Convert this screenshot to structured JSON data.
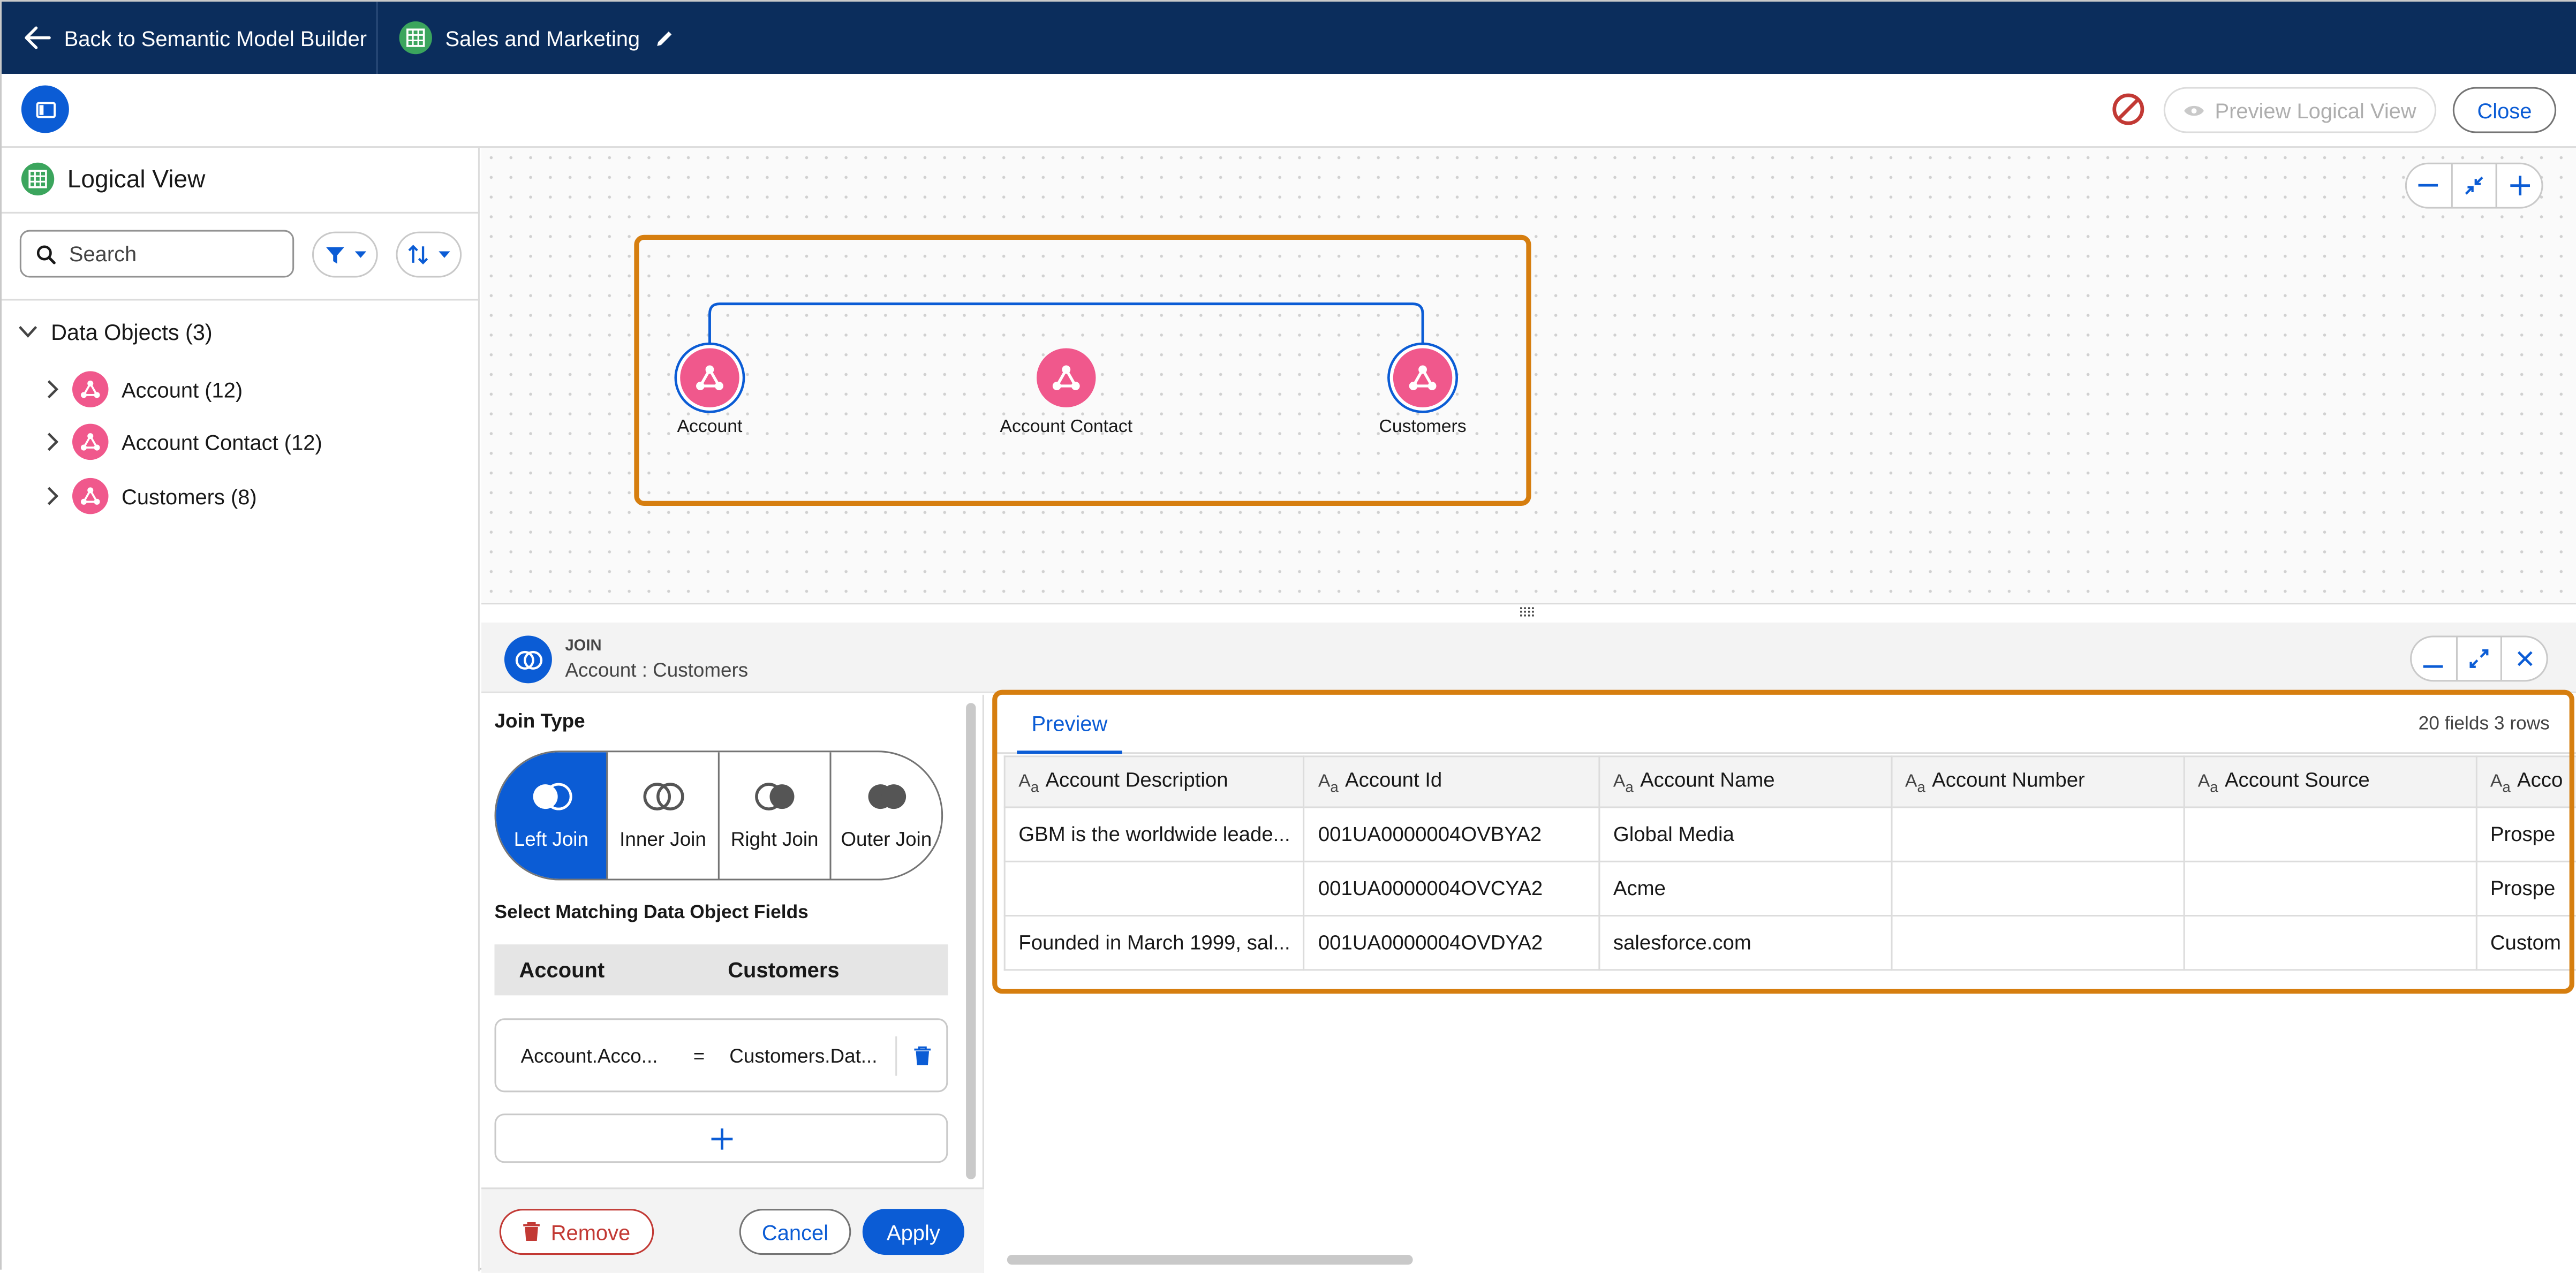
{
  "colors": {
    "nav_bg": "#0b2d5c",
    "brand_blue": "#0b5cd5",
    "object_pink": "#f0588c",
    "highlight_orange": "#d67e0f",
    "destructive": "#c23934"
  },
  "topnav": {
    "back_label": "Back to Semantic Model Builder",
    "model_name": "Sales and Marketing"
  },
  "toolbar": {
    "preview_label": "Preview Logical View",
    "close_label": "Close"
  },
  "sidebar": {
    "title": "Logical View",
    "search_placeholder": "Search",
    "group_label": "Data Objects (3)",
    "items": [
      {
        "label": "Account (12)"
      },
      {
        "label": "Account Contact (12)"
      },
      {
        "label": "Customers (8)"
      }
    ]
  },
  "canvas": {
    "nodes": [
      {
        "label": "Account"
      },
      {
        "label": "Account Contact"
      },
      {
        "label": "Customers"
      }
    ]
  },
  "join": {
    "kicker": "JOIN",
    "title": "Account : Customers",
    "join_type_label": "Join Type",
    "types": [
      {
        "label": "Left Join"
      },
      {
        "label": "Inner Join"
      },
      {
        "label": "Right Join"
      },
      {
        "label": "Outer Join"
      }
    ],
    "selected_type": "Left Join",
    "matching_label": "Select Matching Data Object Fields",
    "left_object": "Account",
    "right_object": "Customers",
    "mapping": {
      "left": "Account.Acco...",
      "operator": "=",
      "right": "Customers.Dat..."
    },
    "remove_label": "Remove",
    "cancel_label": "Cancel",
    "apply_label": "Apply"
  },
  "preview": {
    "tab_label": "Preview",
    "summary": "20 fields 3 rows",
    "columns": [
      "Account Description",
      "Account Id",
      "Account Name",
      "Account Number",
      "Account Source",
      "Acco"
    ],
    "rows": [
      [
        "GBM is the worldwide leade...",
        "001UA0000004OVBYA2",
        "Global Media",
        "",
        "",
        "Prospe"
      ],
      [
        "",
        "001UA0000004OVCYA2",
        "Acme",
        "",
        "",
        "Prospe"
      ],
      [
        "Founded in March 1999, sal...",
        "001UA0000004OVDYA2",
        "salesforce.com",
        "",
        "",
        "Custom"
      ]
    ]
  }
}
